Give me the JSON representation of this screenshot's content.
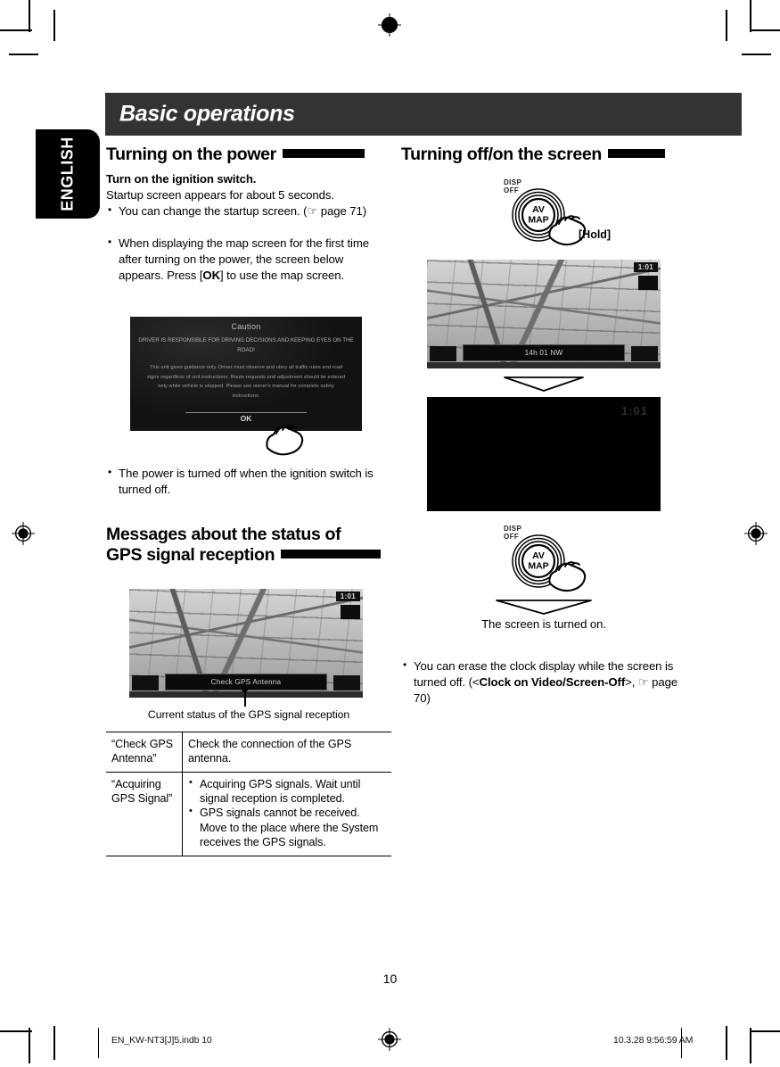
{
  "language_tab": {
    "label": "ENGLISH"
  },
  "chapter": {
    "title": "Basic operations"
  },
  "left_column": {
    "section1": {
      "heading": "Turning on the power",
      "subhead": "Turn on the ignition switch.",
      "intro": "Startup screen appears for about 5 seconds.",
      "bullets": [
        "You can change the startup screen. (☞ page 71)",
        "When displaying the map screen for the first time after turning on the power, the screen below appears. Press [OK] to use the map screen.",
        "The power is turned off when the ignition switch is turned off."
      ],
      "bullet2_prefix": "When displaying the map screen for the first time after turning on the power, the screen below appears. Press [",
      "bullet2_bold": "OK",
      "bullet2_suffix": "] to use the map screen.",
      "caution_screen": {
        "title": "Caution",
        "line1": "DRIVER IS RESPONSIBLE FOR DRIVING DECISIONS AND KEEPING EYES ON THE ROAD!",
        "line2": "This unit gives guidance only. Driver must observe and obey all traffic rules and road signs regardless of unit instructions. Route requests and adjustment should be entered only while vehicle is stopped. Please see owner's manual for complete safety instructions.",
        "ok_label": "OK"
      }
    },
    "section2": {
      "heading_line1": "Messages about the status of",
      "heading_line2": "GPS signal reception",
      "map_status_text": "Check GPS Antenna",
      "map_clock": "1:01",
      "caption": "Current status of the GPS signal reception",
      "table": {
        "rows": [
          {
            "message": "“Check GPS Antenna”",
            "description_type": "text",
            "description": "Check the connection of the GPS antenna."
          },
          {
            "message": "“Acquiring GPS Signal”",
            "description_type": "list",
            "description_items": [
              "Acquiring GPS signals. Wait until signal reception is completed.",
              "GPS signals cannot be received. Move to the place where the System receives the GPS signals."
            ]
          }
        ]
      }
    }
  },
  "right_column": {
    "section1": {
      "heading": "Turning off/on the screen",
      "button_top": {
        "disp_off_label": "DISP OFF",
        "button_line1": "AV",
        "button_line2": "MAP",
        "action_label": "[Hold]"
      },
      "map_screen": {
        "status_clock": "1:01",
        "bottom_text": "14h 01 NW"
      },
      "screen_off": {
        "clock": "1:01"
      },
      "button_bottom": {
        "disp_off_label": "DISP OFF",
        "button_line1": "AV",
        "button_line2": "MAP"
      },
      "result_caption": "The screen is turned on.",
      "bullet_prefix": "You can erase the clock display while the screen is turned off. (<",
      "bullet_bold": "Clock on Video/Screen-Off",
      "bullet_suffix": ">, ☞ page 70)"
    }
  },
  "page_number": "10",
  "footer": {
    "filename": "EN_KW-NT3[J]5.indb   10",
    "timestamp": "10.3.28   9:56:59 AM"
  }
}
